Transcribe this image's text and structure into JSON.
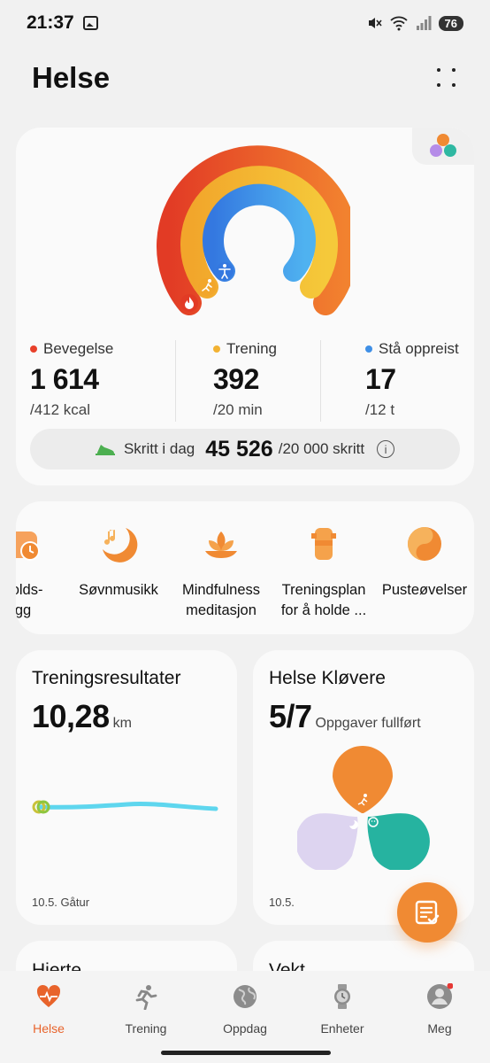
{
  "status_bar": {
    "time": "21:37",
    "battery": "76"
  },
  "header": {
    "title": "Helse"
  },
  "rings": {
    "colors": {
      "move": "#e8402a",
      "exercise": "#f2b233",
      "stand": "#3f8fe6"
    },
    "metrics": [
      {
        "label": "Bevegelse",
        "value": "1 614",
        "goal": "/412 kcal",
        "color": "#e8402a"
      },
      {
        "label": "Trening",
        "value": "392",
        "goal": "/20 min",
        "color": "#f2b233"
      },
      {
        "label": "Stå oppreist",
        "value": "17",
        "goal": "/12 t",
        "color": "#3f8fe6"
      }
    ],
    "steps": {
      "label": "Skritt i dag",
      "value": "45 526",
      "goal": "/20 000 skritt"
    }
  },
  "services": [
    {
      "label_line1": "nolds-",
      "label_line2": "gg",
      "icon": "clock-icon"
    },
    {
      "label_line1": "Søvnmusikk",
      "label_line2": "",
      "icon": "music-moon-icon"
    },
    {
      "label_line1": "Mindfulness",
      "label_line2": "meditasjon",
      "icon": "lotus-icon"
    },
    {
      "label_line1": "Treningsplan",
      "label_line2": "for å holde ...",
      "icon": "body-icon"
    },
    {
      "label_line1": "Pusteøvelser",
      "label_line2": "",
      "icon": "breathing-icon"
    }
  ],
  "workout": {
    "title": "Treningsresultater",
    "value": "10,28",
    "unit": "km",
    "footer": "10.5. Gåtur"
  },
  "clover": {
    "title": "Helse Kløvere",
    "value": "5/7",
    "subtitle": "Oppgaver fullført",
    "footer": "10.5."
  },
  "peek_cards": {
    "left_title": "Hjerte",
    "right_title": "Vekt"
  },
  "tabs": [
    {
      "label": "Helse",
      "icon": "heart-icon",
      "active": true
    },
    {
      "label": "Trening",
      "icon": "runner-icon",
      "active": false
    },
    {
      "label": "Oppdag",
      "icon": "globe-icon",
      "active": false
    },
    {
      "label": "Enheter",
      "icon": "watch-icon",
      "active": false
    },
    {
      "label": "Meg",
      "icon": "profile-icon",
      "active": false
    }
  ]
}
